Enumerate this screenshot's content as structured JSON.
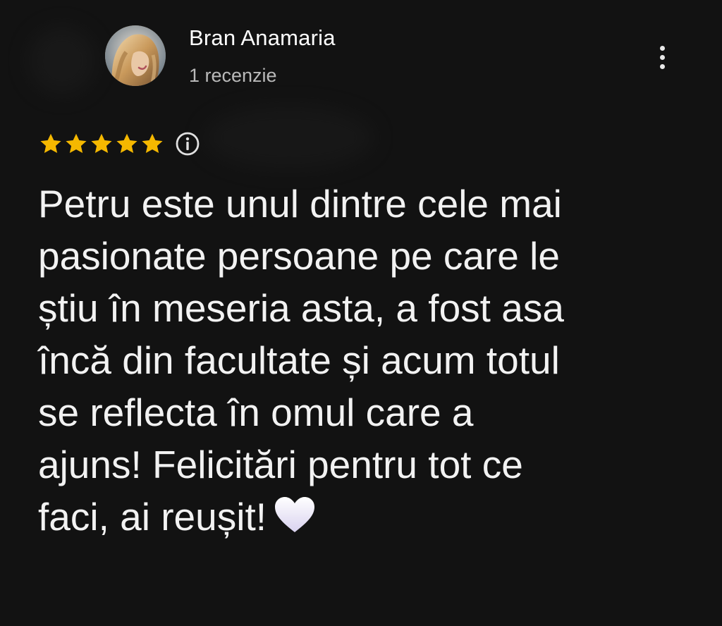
{
  "review": {
    "author_name": "Bran Anamaria",
    "review_count_label": "1 recenzie",
    "rating": 5,
    "rating_max": 5,
    "text_lines": [
      "Petru este unul dintre cele mai",
      "pasionate persoane pe care le",
      "știu în meseria asta, a fost asa",
      "încă din facultate și acum totul",
      "se reflecta în omul care a",
      "ajuns! Felicitări pentru tot ce",
      "faci, ai reușit!"
    ],
    "trailing_emoji": "white-heart"
  },
  "icons": {
    "more": "more-vert-icon",
    "info": "info-icon",
    "star": "star-icon"
  },
  "colors": {
    "background": "#121212",
    "star": "#f5b800",
    "primary_text": "#ffffff",
    "secondary_text": "#b9b9b9"
  }
}
